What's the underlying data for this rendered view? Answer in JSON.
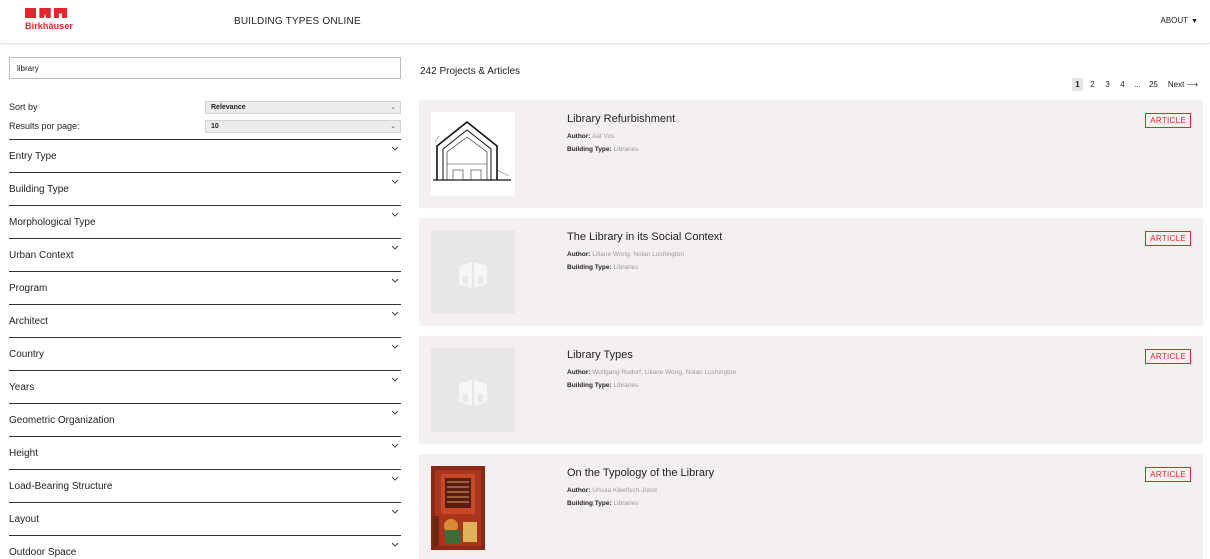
{
  "header": {
    "logo_text": "Birkhäuser",
    "site_title": "BUILDING TYPES ONLINE",
    "about_label": "ABOUT",
    "about_caret": "▼"
  },
  "search": {
    "value": "library"
  },
  "sort": {
    "sort_by_label": "Sort by",
    "sort_by_value": "Relevance",
    "per_page_label": "Results por page:",
    "per_page_value": "10",
    "chevron": "⌄"
  },
  "filters": [
    {
      "label": "Entry Type"
    },
    {
      "label": "Building Type"
    },
    {
      "label": "Morphological Type"
    },
    {
      "label": "Urban Context"
    },
    {
      "label": "Program"
    },
    {
      "label": "Architect"
    },
    {
      "label": "Country"
    },
    {
      "label": "Years"
    },
    {
      "label": "Geometric Organization"
    },
    {
      "label": "Height"
    },
    {
      "label": "Load-Bearing Structure"
    },
    {
      "label": "Layout"
    },
    {
      "label": "Outdoor Space"
    }
  ],
  "results": {
    "count": "242 Projects & Articles",
    "pagination": {
      "pages": [
        "1",
        "2",
        "3",
        "4",
        "...",
        "25"
      ],
      "active": "1",
      "next_label": "Next",
      "next_arrow": "⟶"
    },
    "author_label": "Author:",
    "building_type_label": "Building Type:",
    "items": [
      {
        "title": "Library Refurbishment",
        "author": "Aat Vos",
        "building_type": "Libraries",
        "badge": "ARTICLE",
        "thumb": "drawing-icon"
      },
      {
        "title": "The Library in its Social Context",
        "author": "Liliane Wong, Nolan Lushington",
        "building_type": "Libraries",
        "badge": "ARTICLE",
        "thumb": "placeholder-book-icon"
      },
      {
        "title": "Library Types",
        "author": "Wolfgang Rudorf, Liliane Wong, Nolan Lushington",
        "building_type": "Libraries",
        "badge": "ARTICLE",
        "thumb": "placeholder-book-icon"
      },
      {
        "title": "On the Typology of the Library",
        "author": "Ursula Kleefisch-Jobst",
        "building_type": "Libraries",
        "badge": "ARTICLE",
        "thumb": "painting-image"
      }
    ]
  },
  "colors": {
    "brand_red": "#e3262d",
    "card_bg": "#f5f0f0"
  }
}
